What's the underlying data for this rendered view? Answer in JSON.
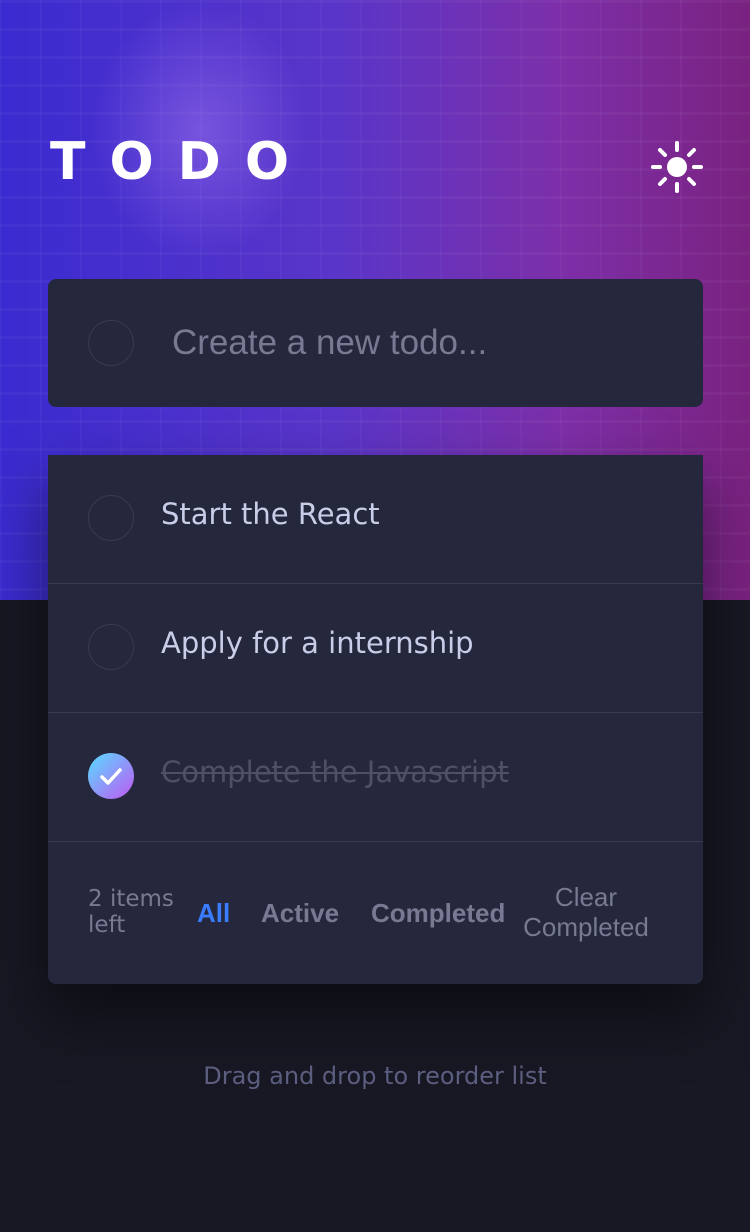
{
  "header": {
    "title": "TODO",
    "theme_toggle_icon": "sun-icon"
  },
  "new_todo": {
    "placeholder": "Create a new todo...",
    "value": ""
  },
  "todos": [
    {
      "text": "Start the React",
      "completed": false
    },
    {
      "text": "Apply for a internship",
      "completed": false
    },
    {
      "text": "Complete the Javascript",
      "completed": true
    }
  ],
  "footer": {
    "items_left": "2 items left",
    "filters": [
      "All",
      "Active",
      "Completed"
    ],
    "active_filter": "All",
    "clear_label": "Clear Completed"
  },
  "hint": "Drag and drop to reorder list",
  "colors": {
    "background": "#181824",
    "card": "#25273c",
    "active_filter": "#3a7cfd",
    "check_gradient_start": "#57ddff",
    "check_gradient_end": "#c058f3"
  }
}
